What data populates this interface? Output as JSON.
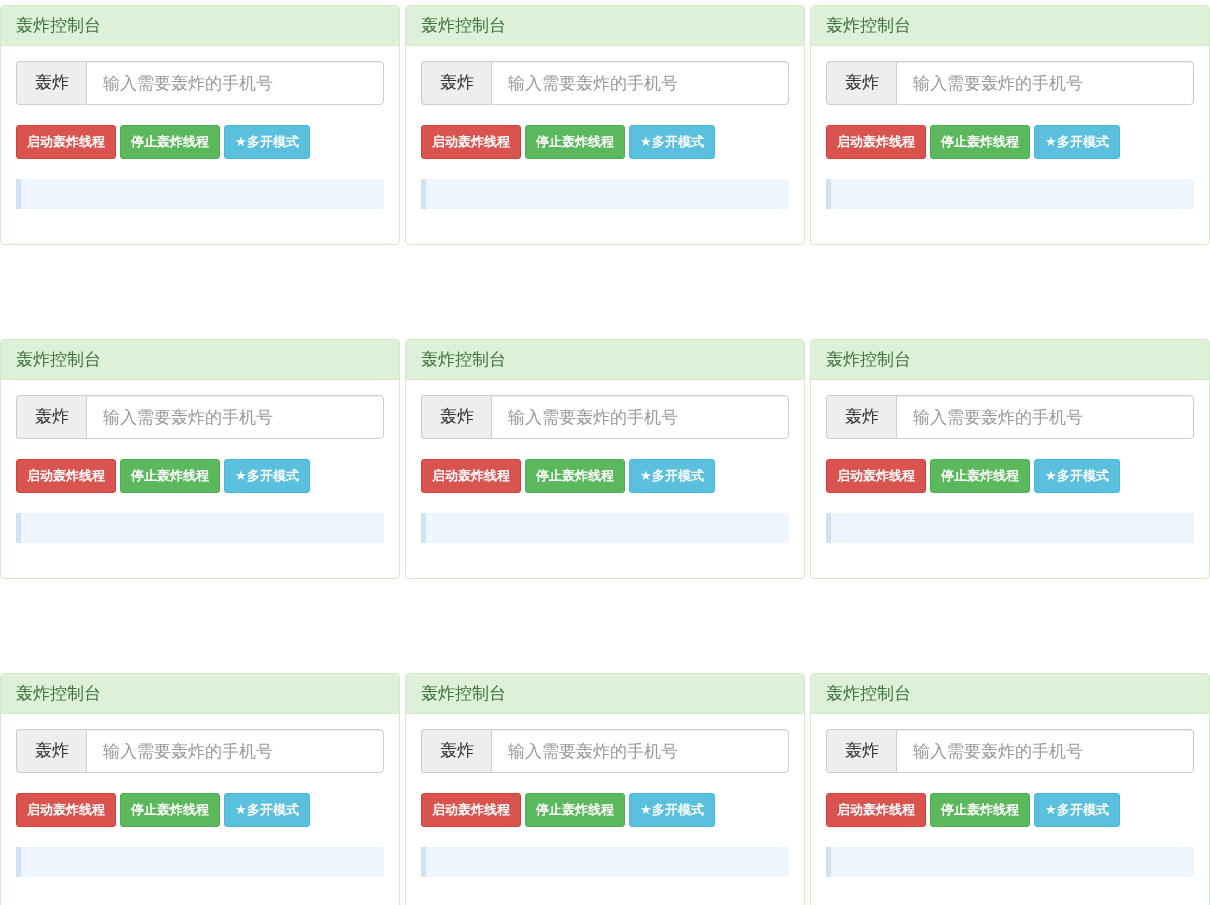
{
  "panels": [
    {
      "title": "轰炸控制台",
      "addon": "轰炸",
      "placeholder": "输入需要轰炸的手机号",
      "buttons": [
        {
          "label": "启动轰炸线程",
          "kind": "danger"
        },
        {
          "label": "停止轰炸线程",
          "kind": "success"
        },
        {
          "label": "★多开模式",
          "kind": "info"
        }
      ]
    },
    {
      "title": "轰炸控制台",
      "addon": "轰炸",
      "placeholder": "输入需要轰炸的手机号",
      "buttons": [
        {
          "label": "启动轰炸线程",
          "kind": "danger"
        },
        {
          "label": "停止轰炸线程",
          "kind": "success"
        },
        {
          "label": "★多开模式",
          "kind": "info"
        }
      ]
    },
    {
      "title": "轰炸控制台",
      "addon": "轰炸",
      "placeholder": "输入需要轰炸的手机号",
      "buttons": [
        {
          "label": "启动轰炸线程",
          "kind": "danger"
        },
        {
          "label": "停止轰炸线程",
          "kind": "success"
        },
        {
          "label": "★多开模式",
          "kind": "info"
        }
      ]
    },
    {
      "title": "轰炸控制台",
      "addon": "轰炸",
      "placeholder": "输入需要轰炸的手机号",
      "buttons": [
        {
          "label": "启动轰炸线程",
          "kind": "danger"
        },
        {
          "label": "停止轰炸线程",
          "kind": "success"
        },
        {
          "label": "★多开模式",
          "kind": "info"
        }
      ]
    },
    {
      "title": "轰炸控制台",
      "addon": "轰炸",
      "placeholder": "输入需要轰炸的手机号",
      "buttons": [
        {
          "label": "启动轰炸线程",
          "kind": "danger"
        },
        {
          "label": "停止轰炸线程",
          "kind": "success"
        },
        {
          "label": "★多开模式",
          "kind": "info"
        }
      ]
    },
    {
      "title": "轰炸控制台",
      "addon": "轰炸",
      "placeholder": "输入需要轰炸的手机号",
      "buttons": [
        {
          "label": "启动轰炸线程",
          "kind": "danger"
        },
        {
          "label": "停止轰炸线程",
          "kind": "success"
        },
        {
          "label": "★多开模式",
          "kind": "info"
        }
      ]
    },
    {
      "title": "轰炸控制台",
      "addon": "轰炸",
      "placeholder": "输入需要轰炸的手机号",
      "buttons": [
        {
          "label": "启动轰炸线程",
          "kind": "danger"
        },
        {
          "label": "停止轰炸线程",
          "kind": "success"
        },
        {
          "label": "★多开模式",
          "kind": "info"
        }
      ]
    },
    {
      "title": "轰炸控制台",
      "addon": "轰炸",
      "placeholder": "输入需要轰炸的手机号",
      "buttons": [
        {
          "label": "启动轰炸线程",
          "kind": "danger"
        },
        {
          "label": "停止轰炸线程",
          "kind": "success"
        },
        {
          "label": "★多开模式",
          "kind": "info"
        }
      ]
    },
    {
      "title": "轰炸控制台",
      "addon": "轰炸",
      "placeholder": "输入需要轰炸的手机号",
      "buttons": [
        {
          "label": "启动轰炸线程",
          "kind": "danger"
        },
        {
          "label": "停止轰炸线程",
          "kind": "success"
        },
        {
          "label": "★多开模式",
          "kind": "info"
        }
      ]
    }
  ]
}
